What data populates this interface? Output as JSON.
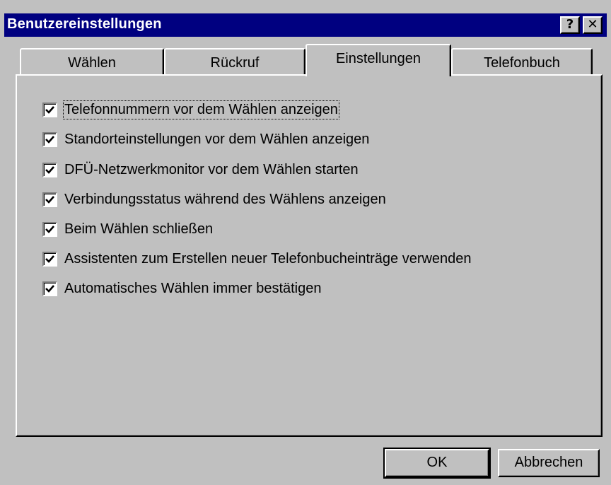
{
  "window": {
    "title": "Benutzereinstellungen",
    "help_label": "?",
    "close_label": "✕"
  },
  "tabs": [
    {
      "label": "Wählen",
      "active": false
    },
    {
      "label": "Rückruf",
      "active": false
    },
    {
      "label": "Einstellungen",
      "active": true
    },
    {
      "label": "Telefonbuch",
      "active": false
    }
  ],
  "options": [
    {
      "label": "Telefonnummern vor dem Wählen anzeigen",
      "checked": true
    },
    {
      "label": "Standorteinstellungen vor dem Wählen anzeigen",
      "checked": true
    },
    {
      "label": "DFÜ-Netzwerkmonitor vor dem Wählen starten",
      "checked": true
    },
    {
      "label": "Verbindungsstatus während des Wählens anzeigen",
      "checked": true
    },
    {
      "label": "Beim Wählen schließen",
      "checked": true
    },
    {
      "label": "Assistenten zum Erstellen neuer Telefonbucheinträge verwenden",
      "checked": true
    },
    {
      "label": "Automatisches Wählen immer bestätigen",
      "checked": true
    }
  ],
  "buttons": {
    "ok": "OK",
    "cancel": "Abbrechen"
  },
  "colors": {
    "titlebar": "#000080",
    "face": "#c0c0c0"
  }
}
